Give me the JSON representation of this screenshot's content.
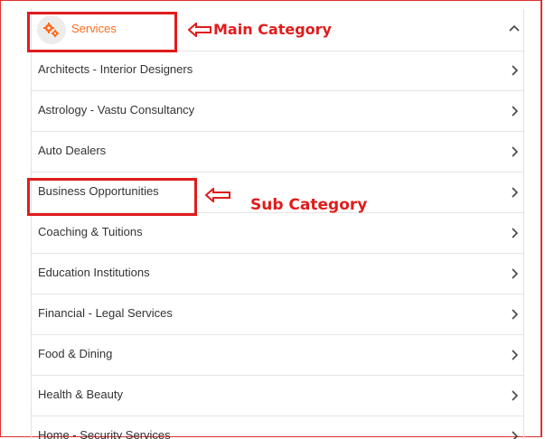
{
  "main_category": {
    "label": "Services",
    "icon": "gears-icon",
    "expanded": true
  },
  "sub_categories": [
    {
      "label": "Architects - Interior Designers"
    },
    {
      "label": "Astrology - Vastu Consultancy"
    },
    {
      "label": "Auto Dealers"
    },
    {
      "label": "Business Opportunities"
    },
    {
      "label": "Coaching & Tuitions"
    },
    {
      "label": "Education Institutions"
    },
    {
      "label": "Financial - Legal Services"
    },
    {
      "label": "Food & Dining"
    },
    {
      "label": "Health & Beauty"
    },
    {
      "label": "Home - Security Services"
    }
  ],
  "annotations": {
    "main": "Main Category",
    "sub": "Sub Category"
  },
  "colors": {
    "accent": "#ff6a1a",
    "annotation": "#e01c1c",
    "text": "#333333",
    "divider": "#e4e4e4"
  }
}
